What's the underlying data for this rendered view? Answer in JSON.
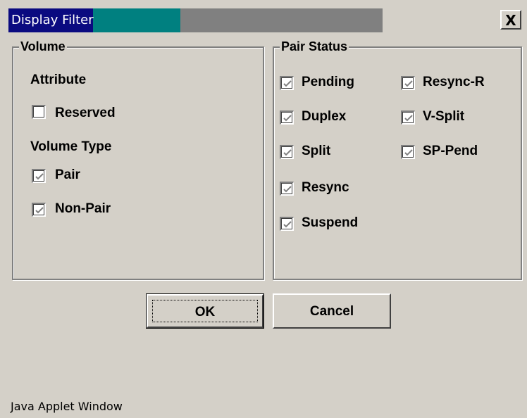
{
  "window": {
    "title": "Display Filter",
    "close_label": "X",
    "status_text": "Java Applet Window"
  },
  "volume": {
    "legend": "Volume",
    "attribute_heading": "Attribute",
    "reserved": {
      "label": "Reserved",
      "checked": false
    },
    "volume_type_heading": "Volume Type",
    "pair": {
      "label": "Pair",
      "checked": true
    },
    "non_pair": {
      "label": "Non-Pair",
      "checked": true
    }
  },
  "pair_status": {
    "legend": "Pair Status",
    "items": [
      {
        "label": "Pending",
        "checked": true
      },
      {
        "label": "Duplex",
        "checked": true
      },
      {
        "label": "Split",
        "checked": true
      },
      {
        "label": "Resync",
        "checked": true
      },
      {
        "label": "Suspend",
        "checked": true
      },
      {
        "label": "Resync-R",
        "checked": true
      },
      {
        "label": "V-Split",
        "checked": true
      },
      {
        "label": "SP-Pend",
        "checked": true
      }
    ]
  },
  "buttons": {
    "ok": "OK",
    "cancel": "Cancel"
  }
}
